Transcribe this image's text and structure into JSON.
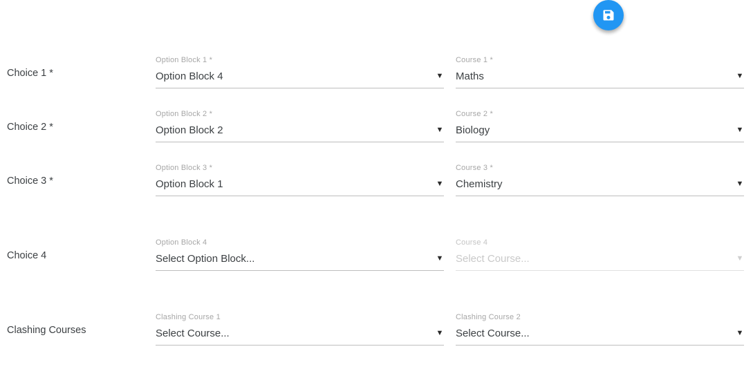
{
  "toolbar": {
    "save_button_label": "Save",
    "save_icon": "floppy-disk-save-icon",
    "accent_color": "#2196f3"
  },
  "form": {
    "rows": [
      {
        "label": "Choice 1 *",
        "fields": [
          {
            "label": "Option Block 1 *",
            "value": "Option Block 4",
            "is_placeholder": false,
            "disabled": false,
            "chevron": "▼"
          },
          {
            "label": "Course 1 *",
            "value": "Maths",
            "is_placeholder": false,
            "disabled": false,
            "chevron": "▼"
          }
        ]
      },
      {
        "label": "Choice 2 *",
        "fields": [
          {
            "label": "Option Block 2 *",
            "value": "Option Block 2",
            "is_placeholder": false,
            "disabled": false,
            "chevron": "▼"
          },
          {
            "label": "Course 2 *",
            "value": "Biology",
            "is_placeholder": false,
            "disabled": false,
            "chevron": "▼"
          }
        ]
      },
      {
        "label": "Choice 3 *",
        "fields": [
          {
            "label": "Option Block 3 *",
            "value": "Option Block 1",
            "is_placeholder": false,
            "disabled": false,
            "chevron": "▼"
          },
          {
            "label": "Course 3 *",
            "value": "Chemistry",
            "is_placeholder": false,
            "disabled": false,
            "chevron": "▼"
          }
        ]
      },
      {
        "label": "Choice 4",
        "fields": [
          {
            "label": "Option Block 4",
            "value": "Select Option Block...",
            "is_placeholder": true,
            "disabled": false,
            "chevron": "▼"
          },
          {
            "label": "Course 4",
            "value": "Select Course...",
            "is_placeholder": true,
            "disabled": true,
            "chevron": "▼"
          }
        ]
      },
      {
        "label": "Clashing Courses",
        "fields": [
          {
            "label": "Clashing Course 1",
            "value": "Select Course...",
            "is_placeholder": true,
            "disabled": false,
            "chevron": "▼"
          },
          {
            "label": "Clashing Course 2",
            "value": "Select Course...",
            "is_placeholder": true,
            "disabled": false,
            "chevron": "▼"
          }
        ]
      }
    ]
  }
}
